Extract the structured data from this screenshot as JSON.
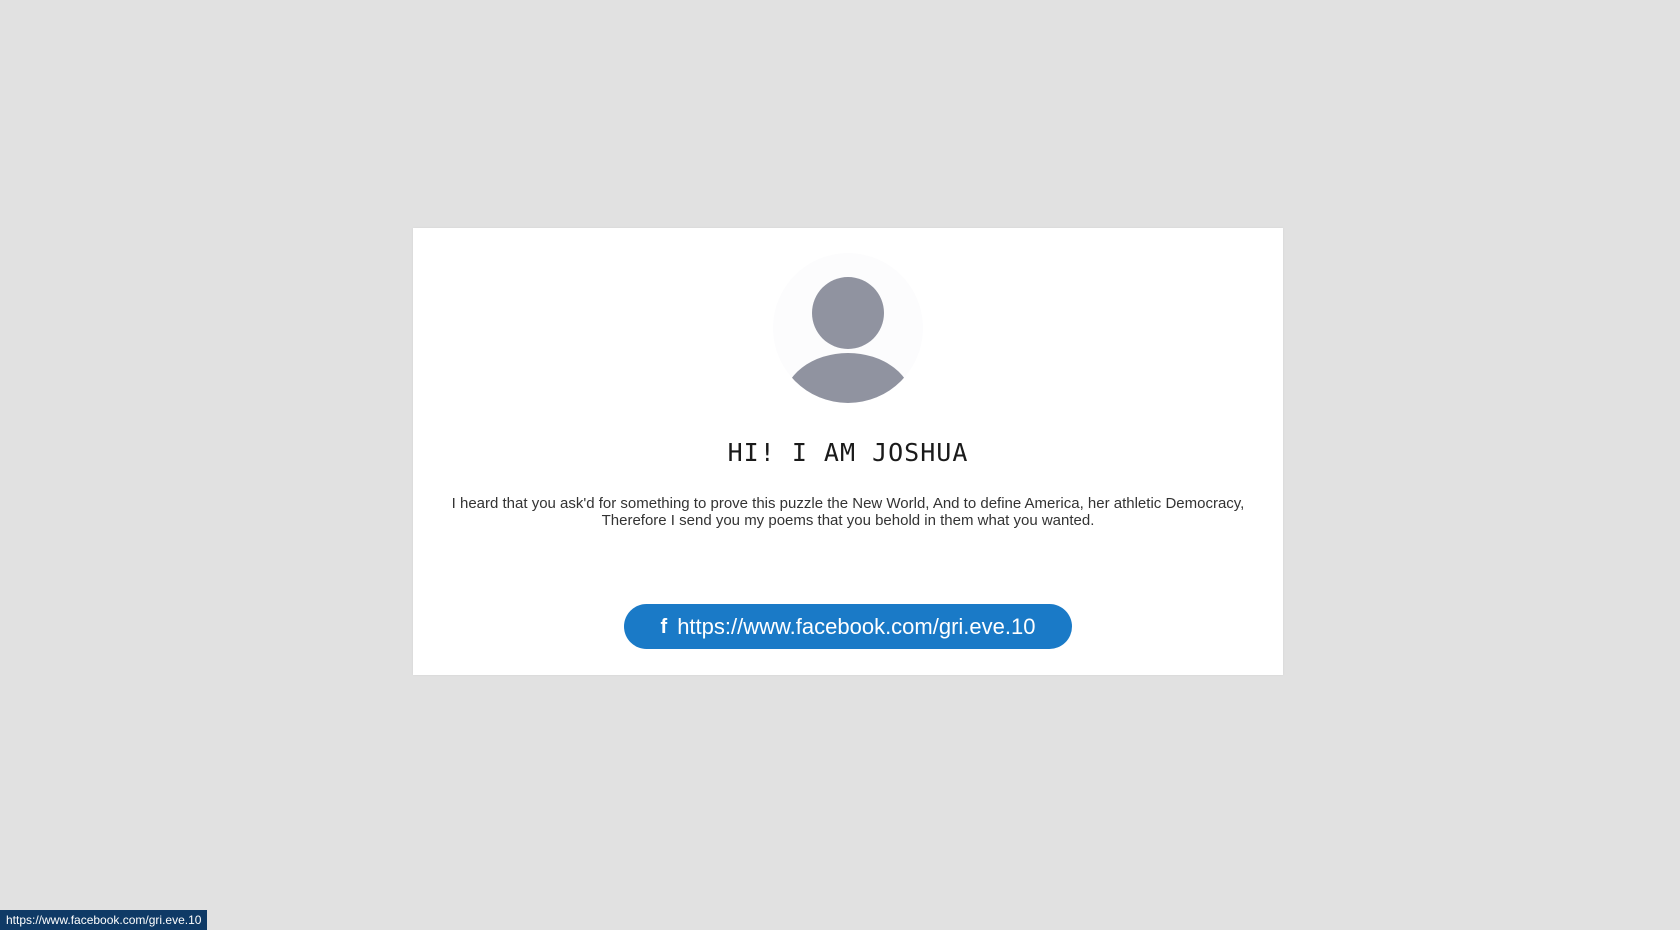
{
  "profile": {
    "avatar_icon": "user-avatar-icon",
    "name": "HI! I AM JOSHUA",
    "bio_line1": "I heard that you ask'd for something to prove this puzzle the New World, And to define America, her athletic Democracy,",
    "bio_line2": "Therefore I send you my poems that you behold in them what you wanted."
  },
  "facebook": {
    "icon": "facebook-icon",
    "icon_glyph": "f",
    "label": "https://www.facebook.com/gri.eve.10"
  },
  "status_bar": {
    "text": "https://www.facebook.com/gri.eve.10"
  },
  "colors": {
    "background": "#e1e1e1",
    "card": "#ffffff",
    "button": "#1a7ac7",
    "avatar_figure": "#9093a0",
    "status_bar": "#0f3a66"
  }
}
